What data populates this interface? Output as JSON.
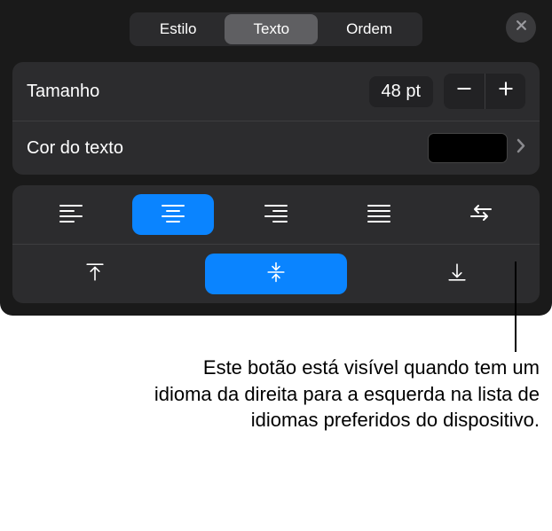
{
  "header": {
    "tabs": [
      "Estilo",
      "Texto",
      "Ordem"
    ],
    "active_tab_index": 1
  },
  "size_row": {
    "label": "Tamanho",
    "value": "48 pt"
  },
  "color_row": {
    "label": "Cor do texto",
    "swatch_color": "#000000"
  },
  "horizontal_align": {
    "active_index": 1,
    "items": [
      "align-left",
      "align-center",
      "align-right",
      "align-justify",
      "align-rtl"
    ]
  },
  "vertical_align": {
    "active_index": 1,
    "items": [
      "valign-top",
      "valign-middle",
      "valign-bottom"
    ]
  },
  "caption": "Este botão está visível quando tem um idioma da direita para a esquerda na lista de idiomas preferidos do dispositivo."
}
